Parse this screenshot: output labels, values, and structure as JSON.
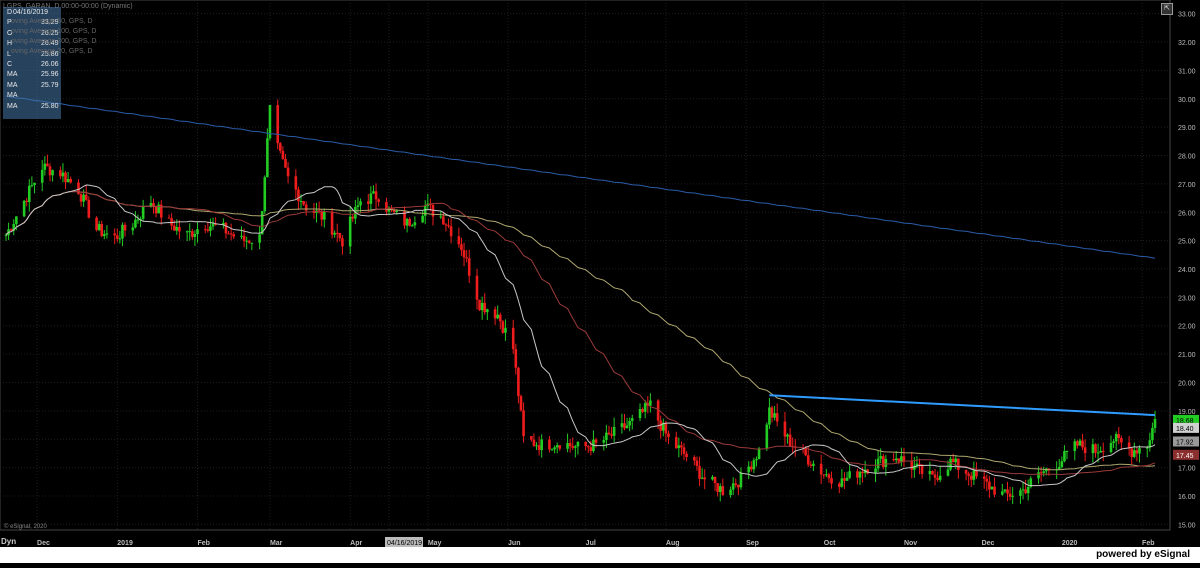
{
  "header": {
    "symbol_line": "LGPS, GARAN, D  00:00-00:00 (Dynamic)",
    "ma_legends": [
      "oving Average 50, GPS, D",
      "oving Average 100, GPS, D",
      "oving Average 200, GPS, D",
      "oving Average 20, GPS, D"
    ]
  },
  "data_window": {
    "rows": [
      {
        "k": "D",
        "v": "04/16/2019"
      },
      {
        "k": "P",
        "v": "33.29"
      },
      {
        "k": "O",
        "v": "26.25"
      },
      {
        "k": "H",
        "v": "26.49"
      },
      {
        "k": "L",
        "v": "25.86"
      },
      {
        "k": "C",
        "v": "26.06"
      },
      {
        "k": "MA",
        "v": "25.96"
      },
      {
        "k": "MA",
        "v": "25.79"
      },
      {
        "k": "MA",
        "v": ""
      },
      {
        "k": "MA",
        "v": "25.80"
      }
    ]
  },
  "footer": {
    "brand": "powered by eSignal",
    "copyright": "© eSignal, 2020",
    "dyn": "Dyn",
    "corner_button": "⇱"
  },
  "colors": {
    "background": "#000000",
    "up_candle": "#22cc22",
    "down_candle": "#ee1c1c",
    "ma200": "#2a5ca8",
    "ma100": "#b0a870",
    "ma50": "#9b3a3a",
    "ma20": "#c8c8c8",
    "trendline": "#2f9bff",
    "grid": "#1e1e1e"
  },
  "chart_data": {
    "type": "candlestick",
    "y_range": [
      14.8,
      33.2
    ],
    "y_ticks": [
      "15.00",
      "16.00",
      "17.00",
      "18.00",
      "19.00",
      "20.00",
      "21.00",
      "22.00",
      "23.00",
      "24.00",
      "25.00",
      "26.00",
      "27.00",
      "28.00",
      "29.00",
      "30.00",
      "31.00",
      "32.00",
      "33.00"
    ],
    "x_labels": [
      "Dec",
      "2019",
      "Feb",
      "Mar",
      "Apr",
      "04/16/2019",
      "May",
      "Jun",
      "Jul",
      "Aug",
      "Sep",
      "Oct",
      "Nov",
      "Dec",
      "2020",
      "Feb"
    ],
    "x_label_dates": [
      "2018-12-01",
      "2019-01-01",
      "2019-02-01",
      "2019-03-01",
      "2019-04-01",
      "2019-04-16",
      "2019-05-01",
      "2019-06-01",
      "2019-07-01",
      "2019-08-01",
      "2019-09-01",
      "2019-10-01",
      "2019-11-01",
      "2019-12-01",
      "2020-01-01",
      "2020-02-01"
    ],
    "highlighted_label": "04/16/2019",
    "date_range": [
      "2018-11-19",
      "2020-02-06"
    ],
    "price_path": [
      [
        "2018-11-19",
        25.2
      ],
      [
        "2018-11-26",
        26.4
      ],
      [
        "2018-12-03",
        27.6
      ],
      [
        "2018-12-10",
        27.4
      ],
      [
        "2018-12-17",
        26.8
      ],
      [
        "2018-12-24",
        25.4
      ],
      [
        "2018-12-31",
        25.1
      ],
      [
        "2019-01-07",
        25.6
      ],
      [
        "2019-01-14",
        26.4
      ],
      [
        "2019-01-21",
        25.6
      ],
      [
        "2019-01-28",
        25.2
      ],
      [
        "2019-02-04",
        25.6
      ],
      [
        "2019-02-11",
        25.4
      ],
      [
        "2019-02-18",
        25.0
      ],
      [
        "2019-02-25",
        25.1
      ],
      [
        "2019-03-01",
        29.6
      ],
      [
        "2019-03-04",
        28.2
      ],
      [
        "2019-03-08",
        27.2
      ],
      [
        "2019-03-15",
        26.2
      ],
      [
        "2019-03-22",
        25.8
      ],
      [
        "2019-03-29",
        25.0
      ],
      [
        "2019-04-05",
        26.4
      ],
      [
        "2019-04-12",
        26.6
      ],
      [
        "2019-04-16",
        26.06
      ],
      [
        "2019-04-23",
        25.6
      ],
      [
        "2019-04-30",
        26.2
      ],
      [
        "2019-05-07",
        25.8
      ],
      [
        "2019-05-14",
        24.8
      ],
      [
        "2019-05-21",
        22.8
      ],
      [
        "2019-05-28",
        22.4
      ],
      [
        "2019-06-03",
        21.2
      ],
      [
        "2019-06-07",
        18.0
      ],
      [
        "2019-06-14",
        17.8
      ],
      [
        "2019-06-21",
        17.9
      ],
      [
        "2019-06-28",
        17.7
      ],
      [
        "2019-07-05",
        17.8
      ],
      [
        "2019-07-12",
        18.2
      ],
      [
        "2019-07-19",
        18.6
      ],
      [
        "2019-07-26",
        19.2
      ],
      [
        "2019-08-02",
        18.0
      ],
      [
        "2019-08-09",
        17.4
      ],
      [
        "2019-08-16",
        16.6
      ],
      [
        "2019-08-23",
        16.2
      ],
      [
        "2019-08-30",
        16.6
      ],
      [
        "2019-09-06",
        17.6
      ],
      [
        "2019-09-10",
        19.0
      ],
      [
        "2019-09-17",
        18.0
      ],
      [
        "2019-09-24",
        17.4
      ],
      [
        "2019-10-01",
        16.8
      ],
      [
        "2019-10-08",
        16.5
      ],
      [
        "2019-10-15",
        16.9
      ],
      [
        "2019-10-22",
        17.2
      ],
      [
        "2019-10-29",
        17.4
      ],
      [
        "2019-11-05",
        17.0
      ],
      [
        "2019-11-12",
        16.6
      ],
      [
        "2019-11-19",
        17.2
      ],
      [
        "2019-11-26",
        16.8
      ],
      [
        "2019-12-03",
        16.4
      ],
      [
        "2019-12-10",
        16.0
      ],
      [
        "2019-12-17",
        16.2
      ],
      [
        "2019-12-24",
        16.8
      ],
      [
        "2019-12-31",
        17.2
      ],
      [
        "2020-01-07",
        17.8
      ],
      [
        "2020-01-14",
        17.6
      ],
      [
        "2020-01-21",
        18.0
      ],
      [
        "2020-01-28",
        17.6
      ],
      [
        "2020-02-03",
        17.8
      ],
      [
        "2020-02-06",
        18.68
      ]
    ],
    "last_values": {
      "close": "18.68",
      "ma200": "18.40",
      "ma20": "17.92",
      "ma50": "17.45"
    },
    "trendline": {
      "from": [
        "2019-09-10",
        19.55
      ],
      "to": [
        "2020-02-06",
        18.85
      ]
    },
    "grid": true
  }
}
